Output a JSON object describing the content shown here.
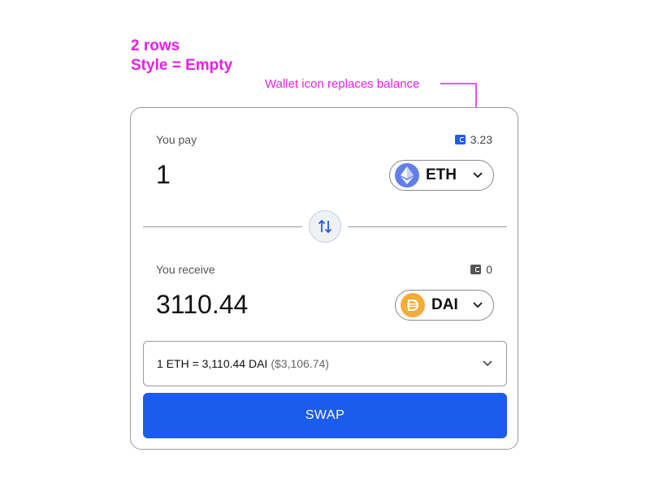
{
  "annotation": {
    "title_line1": "2 rows",
    "title_line2": "Style = Empty",
    "note": "Wallet icon replaces balance",
    "color": "#e91ee9"
  },
  "pay": {
    "label": "You pay",
    "balance": "3.23",
    "wallet_icon": "wallet-icon",
    "wallet_color": "#1d5cf0",
    "amount": "1",
    "token": {
      "symbol": "ETH",
      "icon": "ethereum-icon",
      "color": "#627eea"
    }
  },
  "receive": {
    "label": "You receive",
    "balance": "0",
    "wallet_icon": "wallet-icon",
    "wallet_color": "#555555",
    "amount": "3110.44",
    "token": {
      "symbol": "DAI",
      "icon": "dai-icon",
      "color": "#f5ac37"
    }
  },
  "swap_direction_icon": "swap-arrows-icon",
  "rate": {
    "text": "1 ETH = 3,110.44 DAI",
    "usd": "($3,106.74)"
  },
  "swap_button": {
    "label": "SWAP",
    "color": "#1b5ced"
  }
}
